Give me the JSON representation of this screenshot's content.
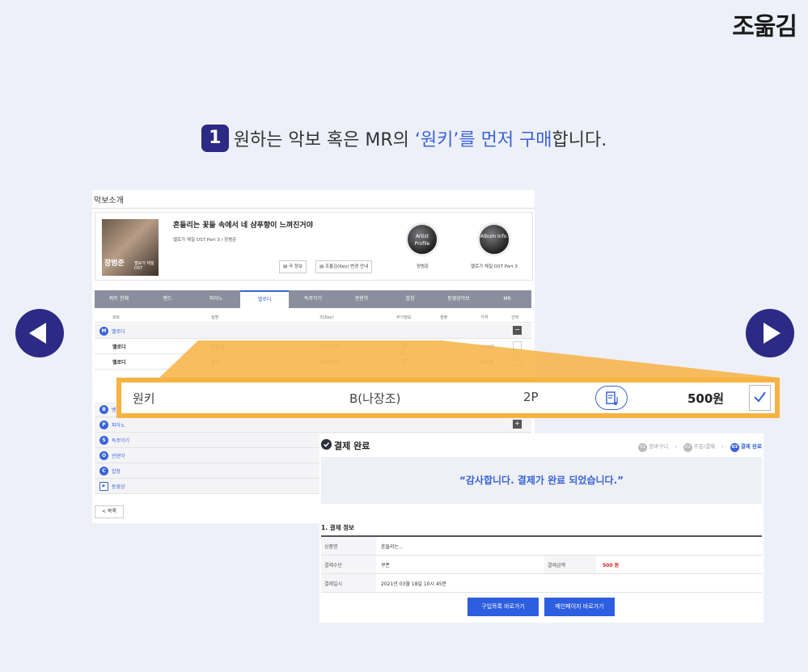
{
  "logo": "조욺김",
  "heading": {
    "step": "1",
    "part1": "원하는 악보 혹은 MR의 ",
    "highlight": "‘원키’를 먼저 구매",
    "part2": "합니다."
  },
  "panel1": {
    "title": "악보소개",
    "song_title": "흔들리는 꽃들 속에서 네 샴푸향이 느껴진거야",
    "song_sub": "멜로가 체질 OST Part 3 / 장범준",
    "album_text": "장범준",
    "album_text2": "멜로가 체질 OST",
    "btn_song_info": "곡 정보",
    "btn_key_change": "조옮김(Key) 변경 안내",
    "artist_profile": "Artist Profile",
    "artist_name": "장범준",
    "album_info": "Album Info.",
    "album_name": "멜로가 체질 OST Part 3",
    "tabs": [
      "파트 전체",
      "밴드",
      "피아노",
      "멜로디",
      "독주악기",
      "관현악",
      "합창",
      "동영상악보",
      "MR"
    ],
    "columns": [
      "파트",
      "설명",
      "조(Key)",
      "부가정보",
      "샘플",
      "가격",
      "선택"
    ],
    "groups": [
      {
        "letter": "M",
        "label": "멜로디"
      },
      {
        "letter": "B",
        "label": "밴드"
      },
      {
        "letter": "P",
        "label": "피아노"
      },
      {
        "letter": "S",
        "label": "독주악기"
      },
      {
        "letter": "O",
        "label": "관현악"
      },
      {
        "letter": "C",
        "label": "합창"
      },
      {
        "letter": "▶",
        "label": "동영상"
      }
    ],
    "rows": [
      {
        "part": "멜로디",
        "desc": "조옮김",
        "key": "C(다장조)",
        "info": "2P",
        "price": "500원"
      },
      {
        "part": "멜로디",
        "desc": "원키",
        "key": "B(나장조)",
        "info": "2P",
        "price": "500원"
      }
    ],
    "list_button": "< 목록"
  },
  "zoom": {
    "desc": "원키",
    "key": "B(나장조)",
    "info": "2P",
    "price": "500원"
  },
  "panel2": {
    "title": "결제 완료",
    "steps": [
      {
        "num": "01",
        "label": "장바구니"
      },
      {
        "num": "02",
        "label": "주문/결제"
      },
      {
        "num": "03",
        "label": "결제 완료"
      }
    ],
    "thanks": "“감사합니다. 결제가 완료 되었습니다.”",
    "section_title": "1. 결제 정보",
    "rows": [
      {
        "k": "상품명",
        "v": "흔들리는..."
      },
      {
        "k": "결제수단",
        "v": "쿠폰",
        "k2": "결제금액",
        "v2": "500 원"
      },
      {
        "k": "결제일시",
        "v": "2021년 03월 18일 10시 45분"
      }
    ],
    "btn_purchase_list": "구입목록 바로가기",
    "btn_main": "메인페이지 바로가기"
  },
  "colors": {
    "accent": "#3a63d8",
    "navy": "#2b2a84",
    "highlight": "#f6b243",
    "price_red": "#e02020"
  }
}
